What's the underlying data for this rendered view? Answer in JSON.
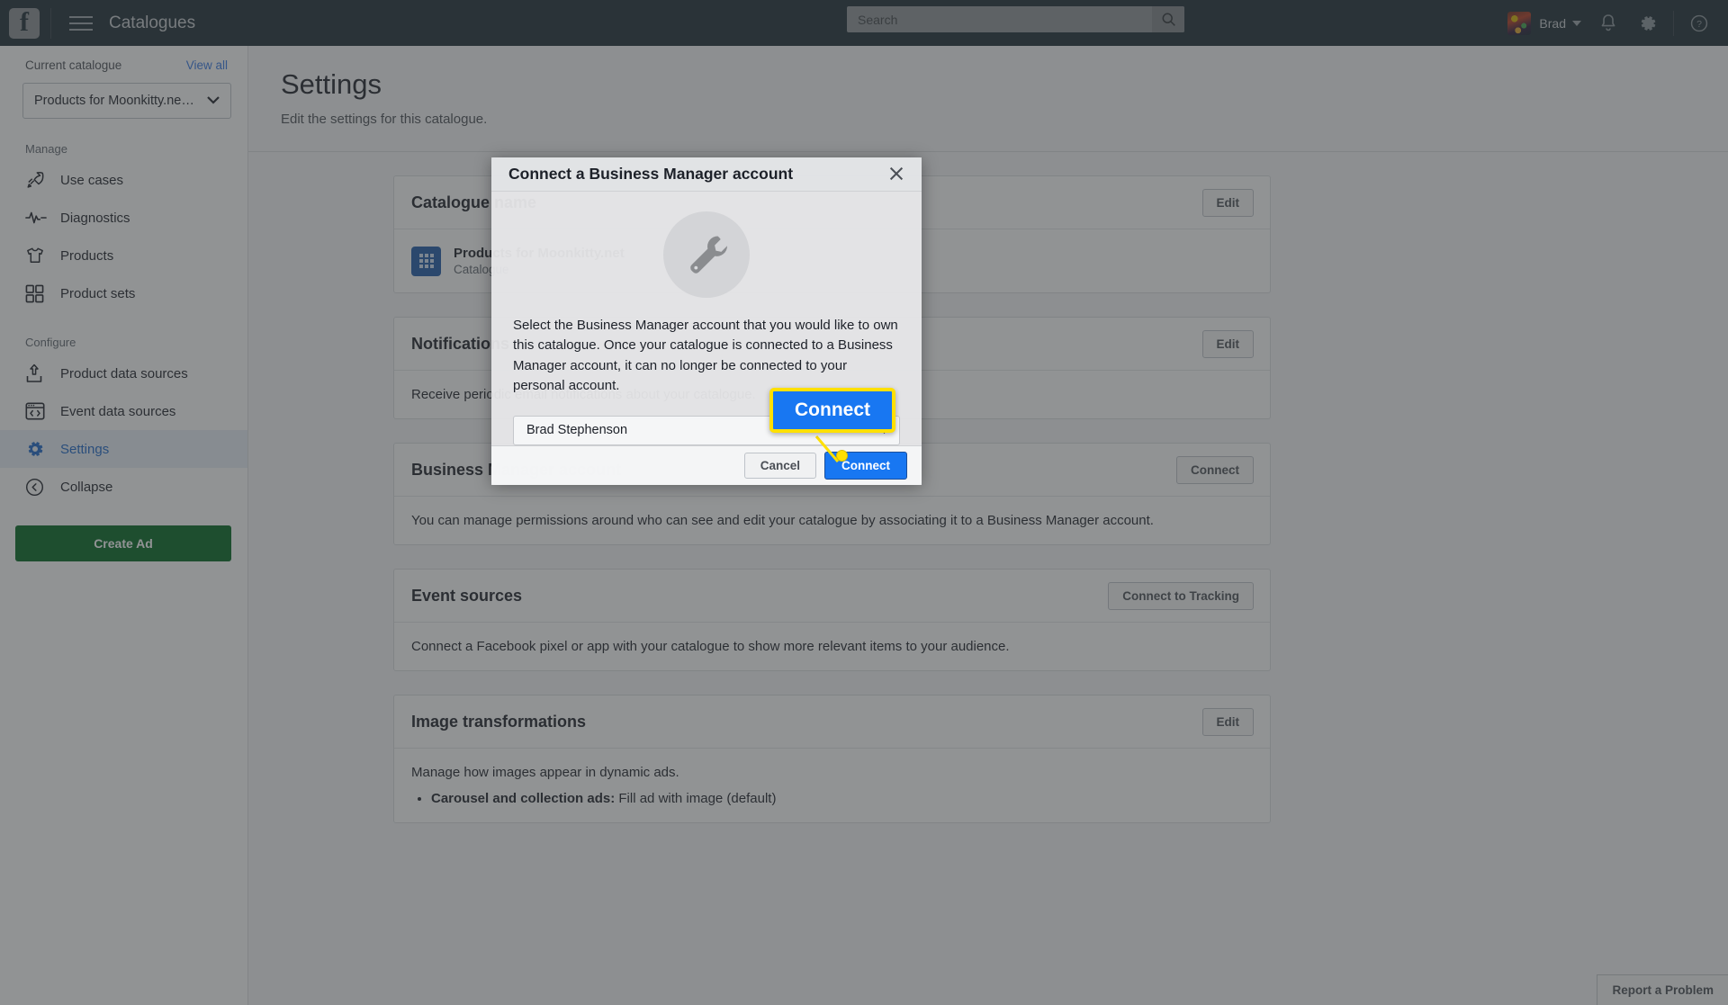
{
  "topbar": {
    "logo_letter": "f",
    "app_title": "Catalogues",
    "search": {
      "placeholder": "Search",
      "value": ""
    },
    "user_name": "Brad",
    "icons": {
      "hamburger": "hamburger-icon",
      "search": "search-icon",
      "notifications": "bell-icon",
      "settings": "gear-icon",
      "help": "question-mark-icon"
    }
  },
  "sidebar": {
    "current_catalogue_label": "Current catalogue",
    "view_all_label": "View all",
    "catalogue_selected": "Products for Moonkitty.ne…",
    "section_manage": "Manage",
    "section_configure": "Configure",
    "manage_items": [
      {
        "label": "Use cases",
        "icon": "rocket-icon"
      },
      {
        "label": "Diagnostics",
        "icon": "pulse-icon"
      },
      {
        "label": "Products",
        "icon": "tshirt-icon"
      },
      {
        "label": "Product sets",
        "icon": "grid-squares-icon"
      }
    ],
    "configure_items": [
      {
        "label": "Product data sources",
        "icon": "upload-icon",
        "active": false
      },
      {
        "label": "Event data sources",
        "icon": "code-window-icon",
        "active": false
      },
      {
        "label": "Settings",
        "icon": "gear-icon",
        "active": true
      }
    ],
    "collapse_label": "Collapse",
    "collapse_icon": "chevron-left-circle-icon",
    "create_ad_label": "Create Ad",
    "create_ad_color": "#006621"
  },
  "main": {
    "title": "Settings",
    "subtitle": "Edit the settings for this catalogue.",
    "cards": [
      {
        "title": "Catalogue name",
        "action": "Edit",
        "item_name": "Products for Moonkitty.net",
        "item_meta": "Catalogue",
        "body": ""
      },
      {
        "title": "Notifications",
        "action": "Edit",
        "body": "Receive periodic email notifications about your catalogue."
      },
      {
        "title": "Business Manager account",
        "action": "Connect",
        "body": "You can manage permissions around who can see and edit your catalogue by associating it to a Business Manager account."
      },
      {
        "title": "Event sources",
        "action": "Connect to Tracking",
        "body": "Connect a Facebook pixel or app with your catalogue to show more relevant items to your audience."
      },
      {
        "title": "Image transformations",
        "action": "Edit",
        "body": "Manage how images appear in dynamic ads.",
        "bullets": [
          {
            "bold": "Carousel and collection ads:",
            "text": " Fill ad with image (default)"
          }
        ]
      }
    ],
    "report_problem_label": "Report a Problem"
  },
  "modal": {
    "title": "Connect a Business Manager account",
    "close_icon": "close-icon",
    "hero_icon": "wrench-icon",
    "body_text": "Select the Business Manager account that you would like to own this catalogue. Once your catalogue is connected to a Business Manager account, it can no longer be connected to your personal account.",
    "select_value": "Brad Stephenson",
    "select_icon": "chevron-down-icon",
    "cancel_label": "Cancel",
    "connect_label": "Connect",
    "connect_color": "#1877f2"
  },
  "callout": {
    "label": "Connect",
    "highlight_color": "#ffe000",
    "fill_color": "#1877f2"
  }
}
